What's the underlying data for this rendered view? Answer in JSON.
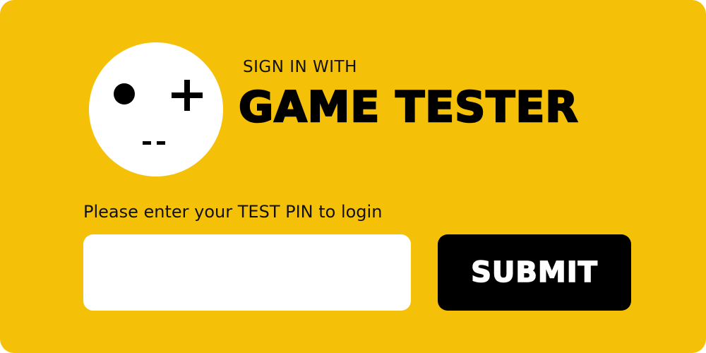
{
  "colors": {
    "background": "#F5C108",
    "logo_circle": "#FFFFFF",
    "text": "#000000",
    "input_background": "#FFFFFF",
    "button_background": "#000000",
    "button_text": "#FFFFFF"
  },
  "logo": {
    "icon": "gamepad-face-icon"
  },
  "header": {
    "subtitle": "SIGN IN WITH",
    "title": "GAME TESTER"
  },
  "form": {
    "prompt": "Please enter your TEST PIN to login",
    "pin_value": "",
    "pin_placeholder": "",
    "submit_label": "SUBMIT"
  }
}
